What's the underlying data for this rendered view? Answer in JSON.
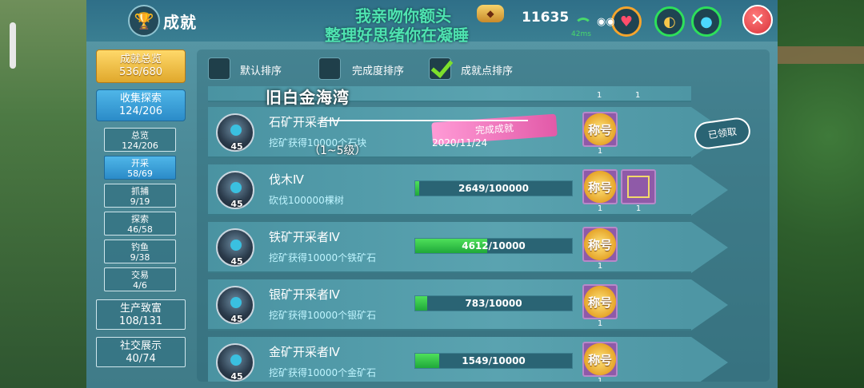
{
  "header": {
    "title": "成就",
    "marquee_line1": "我亲吻你额头",
    "marquee_line2": "整理好思绪你在凝睡",
    "coins": "11635",
    "ping": "42ms"
  },
  "sidebar": {
    "overview": {
      "label": "成就总览",
      "count": "536/680"
    },
    "collect": {
      "label": "收集探索",
      "count": "124/206"
    },
    "sub_items": [
      {
        "label": "总览",
        "count": "124/206"
      },
      {
        "label": "开采",
        "count": "58/69"
      },
      {
        "label": "抓捕",
        "count": "9/19"
      },
      {
        "label": "探索",
        "count": "46/58"
      },
      {
        "label": "钓鱼",
        "count": "9/38"
      },
      {
        "label": "交易",
        "count": "4/6"
      }
    ],
    "production": {
      "label": "生产致富",
      "count": "108/131"
    },
    "social": {
      "label": "社交展示",
      "count": "40/74"
    }
  },
  "sort": {
    "default": "默认排序",
    "completion": "完成度排序",
    "points": "成就点排序"
  },
  "overlay": {
    "location": "旧白金海湾",
    "level_range": "（1~5级）"
  },
  "achievements": [
    {
      "name": "石矿开采者Ⅳ",
      "desc": "挖矿获得10000个石块",
      "level": "45",
      "status": "完成成就",
      "date": "2020/11/24",
      "reward_title": "称号",
      "reward_count": "1",
      "claim": "已领取"
    },
    {
      "name": "伐木Ⅳ",
      "desc": "砍伐100000棵树",
      "level": "45",
      "progress_text": "2649/100000",
      "progress": 0.026,
      "reward_title": "称号",
      "reward_count": "1",
      "reward2_count": "1"
    },
    {
      "name": "铁矿开采者Ⅳ",
      "desc": "挖矿获得10000个铁矿石",
      "level": "45",
      "progress_text": "4612/10000",
      "progress": 0.461,
      "reward_title": "称号",
      "reward_count": "1"
    },
    {
      "name": "银矿开采者Ⅳ",
      "desc": "挖矿获得10000个银矿石",
      "level": "45",
      "progress_text": "783/10000",
      "progress": 0.078,
      "reward_title": "称号",
      "reward_count": "1"
    },
    {
      "name": "金矿开采者Ⅳ",
      "desc": "挖矿获得10000个金矿石",
      "level": "45",
      "progress_text": "1549/10000",
      "progress": 0.155,
      "reward_title": "称号",
      "reward_count": "1"
    }
  ],
  "top_partial_counts": [
    "1",
    "1"
  ],
  "colors": {
    "accent": "#4fb6e8",
    "gold": "#e0a82c",
    "progress": "#1fa83a",
    "marquee": "#4fe3b0"
  }
}
